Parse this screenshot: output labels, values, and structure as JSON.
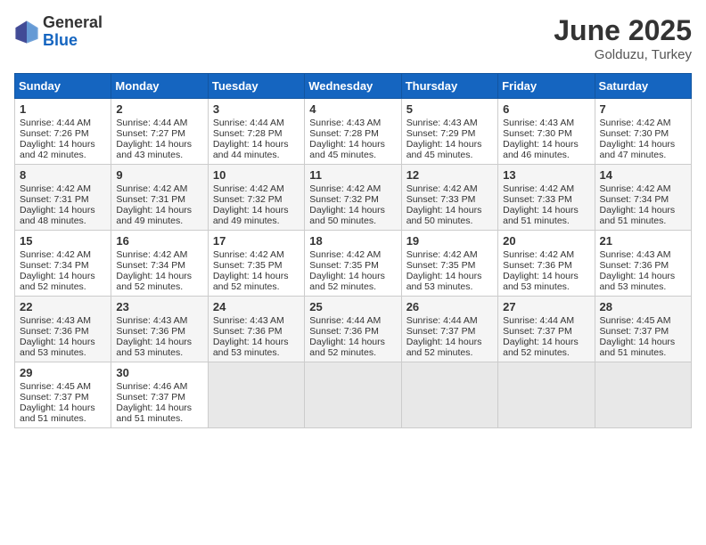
{
  "logo": {
    "general": "General",
    "blue": "Blue"
  },
  "title": {
    "month": "June 2025",
    "location": "Golduzu, Turkey"
  },
  "weekdays": [
    "Sunday",
    "Monday",
    "Tuesday",
    "Wednesday",
    "Thursday",
    "Friday",
    "Saturday"
  ],
  "weeks": [
    [
      {
        "day": "1",
        "sunrise": "4:44 AM",
        "sunset": "7:26 PM",
        "daylight": "14 hours and 42 minutes."
      },
      {
        "day": "2",
        "sunrise": "4:44 AM",
        "sunset": "7:27 PM",
        "daylight": "14 hours and 43 minutes."
      },
      {
        "day": "3",
        "sunrise": "4:44 AM",
        "sunset": "7:28 PM",
        "daylight": "14 hours and 44 minutes."
      },
      {
        "day": "4",
        "sunrise": "4:43 AM",
        "sunset": "7:28 PM",
        "daylight": "14 hours and 45 minutes."
      },
      {
        "day": "5",
        "sunrise": "4:43 AM",
        "sunset": "7:29 PM",
        "daylight": "14 hours and 45 minutes."
      },
      {
        "day": "6",
        "sunrise": "4:43 AM",
        "sunset": "7:30 PM",
        "daylight": "14 hours and 46 minutes."
      },
      {
        "day": "7",
        "sunrise": "4:42 AM",
        "sunset": "7:30 PM",
        "daylight": "14 hours and 47 minutes."
      }
    ],
    [
      {
        "day": "8",
        "sunrise": "4:42 AM",
        "sunset": "7:31 PM",
        "daylight": "14 hours and 48 minutes."
      },
      {
        "day": "9",
        "sunrise": "4:42 AM",
        "sunset": "7:31 PM",
        "daylight": "14 hours and 49 minutes."
      },
      {
        "day": "10",
        "sunrise": "4:42 AM",
        "sunset": "7:32 PM",
        "daylight": "14 hours and 49 minutes."
      },
      {
        "day": "11",
        "sunrise": "4:42 AM",
        "sunset": "7:32 PM",
        "daylight": "14 hours and 50 minutes."
      },
      {
        "day": "12",
        "sunrise": "4:42 AM",
        "sunset": "7:33 PM",
        "daylight": "14 hours and 50 minutes."
      },
      {
        "day": "13",
        "sunrise": "4:42 AM",
        "sunset": "7:33 PM",
        "daylight": "14 hours and 51 minutes."
      },
      {
        "day": "14",
        "sunrise": "4:42 AM",
        "sunset": "7:34 PM",
        "daylight": "14 hours and 51 minutes."
      }
    ],
    [
      {
        "day": "15",
        "sunrise": "4:42 AM",
        "sunset": "7:34 PM",
        "daylight": "14 hours and 52 minutes."
      },
      {
        "day": "16",
        "sunrise": "4:42 AM",
        "sunset": "7:34 PM",
        "daylight": "14 hours and 52 minutes."
      },
      {
        "day": "17",
        "sunrise": "4:42 AM",
        "sunset": "7:35 PM",
        "daylight": "14 hours and 52 minutes."
      },
      {
        "day": "18",
        "sunrise": "4:42 AM",
        "sunset": "7:35 PM",
        "daylight": "14 hours and 52 minutes."
      },
      {
        "day": "19",
        "sunrise": "4:42 AM",
        "sunset": "7:35 PM",
        "daylight": "14 hours and 53 minutes."
      },
      {
        "day": "20",
        "sunrise": "4:42 AM",
        "sunset": "7:36 PM",
        "daylight": "14 hours and 53 minutes."
      },
      {
        "day": "21",
        "sunrise": "4:43 AM",
        "sunset": "7:36 PM",
        "daylight": "14 hours and 53 minutes."
      }
    ],
    [
      {
        "day": "22",
        "sunrise": "4:43 AM",
        "sunset": "7:36 PM",
        "daylight": "14 hours and 53 minutes."
      },
      {
        "day": "23",
        "sunrise": "4:43 AM",
        "sunset": "7:36 PM",
        "daylight": "14 hours and 53 minutes."
      },
      {
        "day": "24",
        "sunrise": "4:43 AM",
        "sunset": "7:36 PM",
        "daylight": "14 hours and 53 minutes."
      },
      {
        "day": "25",
        "sunrise": "4:44 AM",
        "sunset": "7:36 PM",
        "daylight": "14 hours and 52 minutes."
      },
      {
        "day": "26",
        "sunrise": "4:44 AM",
        "sunset": "7:37 PM",
        "daylight": "14 hours and 52 minutes."
      },
      {
        "day": "27",
        "sunrise": "4:44 AM",
        "sunset": "7:37 PM",
        "daylight": "14 hours and 52 minutes."
      },
      {
        "day": "28",
        "sunrise": "4:45 AM",
        "sunset": "7:37 PM",
        "daylight": "14 hours and 51 minutes."
      }
    ],
    [
      {
        "day": "29",
        "sunrise": "4:45 AM",
        "sunset": "7:37 PM",
        "daylight": "14 hours and 51 minutes."
      },
      {
        "day": "30",
        "sunrise": "4:46 AM",
        "sunset": "7:37 PM",
        "daylight": "14 hours and 51 minutes."
      },
      null,
      null,
      null,
      null,
      null
    ]
  ]
}
